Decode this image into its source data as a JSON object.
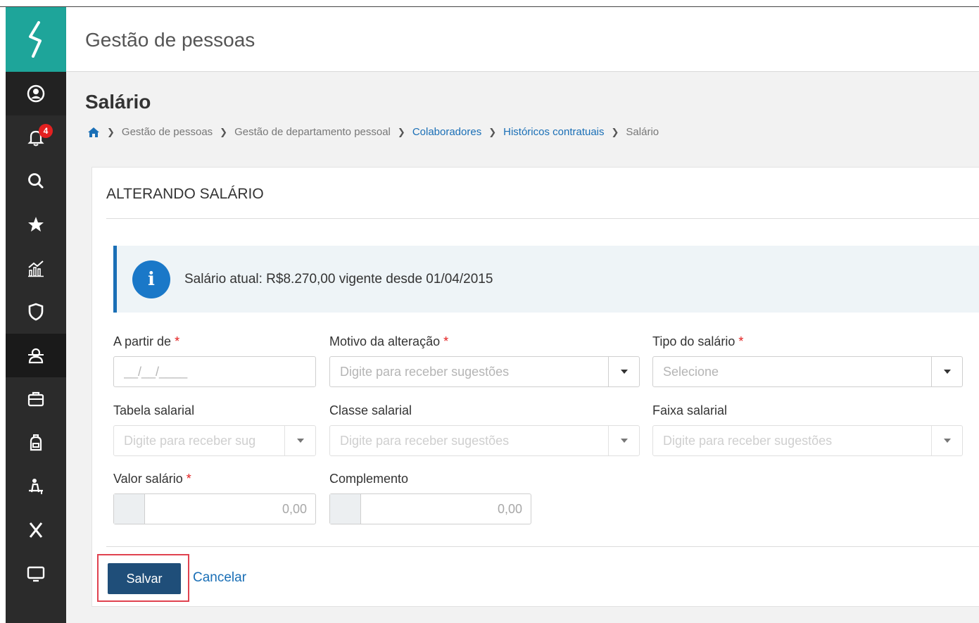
{
  "app": {
    "title": "Gestão de pessoas"
  },
  "sidebar": {
    "items": [
      {
        "name": "user-icon"
      },
      {
        "name": "bell-icon",
        "badge": "4"
      },
      {
        "name": "search-icon"
      },
      {
        "name": "star-icon"
      },
      {
        "name": "chart-icon"
      },
      {
        "name": "shield-icon"
      },
      {
        "name": "people-icon"
      },
      {
        "name": "briefcase-icon"
      },
      {
        "name": "backpack-icon"
      },
      {
        "name": "person-desk-icon"
      },
      {
        "name": "x-icon"
      },
      {
        "name": "monitor-icon"
      }
    ]
  },
  "page": {
    "title": "Salário",
    "breadcrumb": [
      {
        "label": "Gestão de pessoas",
        "link": false
      },
      {
        "label": "Gestão de departamento pessoal",
        "link": false
      },
      {
        "label": "Colaboradores",
        "link": true
      },
      {
        "label": "Históricos contratuais",
        "link": true
      },
      {
        "label": "Salário",
        "link": false
      }
    ]
  },
  "card": {
    "title": "ALTERANDO SALÁRIO",
    "info_icon": "i",
    "info": "Salário atual: R$8.270,00 vigente desde 01/04/2015"
  },
  "form": {
    "a_partir_de": {
      "label": "A partir de",
      "required": "*",
      "placeholder": "__/__/____"
    },
    "motivo": {
      "label": "Motivo da alteração",
      "required": "*",
      "placeholder": "Digite para receber sugestões"
    },
    "tipo": {
      "label": "Tipo do salário",
      "required": "*",
      "placeholder": "Selecione"
    },
    "tabela": {
      "label": "Tabela salarial",
      "placeholder": "Digite para receber sug"
    },
    "classe": {
      "label": "Classe salarial",
      "placeholder": "Digite para receber sugestões"
    },
    "faixa": {
      "label": "Faixa salarial",
      "placeholder": "Digite para receber sugestões"
    },
    "valor": {
      "label": "Valor salário",
      "required": "*",
      "placeholder": "0,00"
    },
    "complemento": {
      "label": "Complemento",
      "placeholder": "0,00"
    }
  },
  "actions": {
    "save": "Salvar",
    "cancel": "Cancelar"
  },
  "colors": {
    "brand": "#1ea59a",
    "sidebar": "#2b2b2b",
    "primary": "#1f4e79",
    "link": "#1a6fb6",
    "required": "#e32020",
    "highlight": "#e0424f"
  }
}
